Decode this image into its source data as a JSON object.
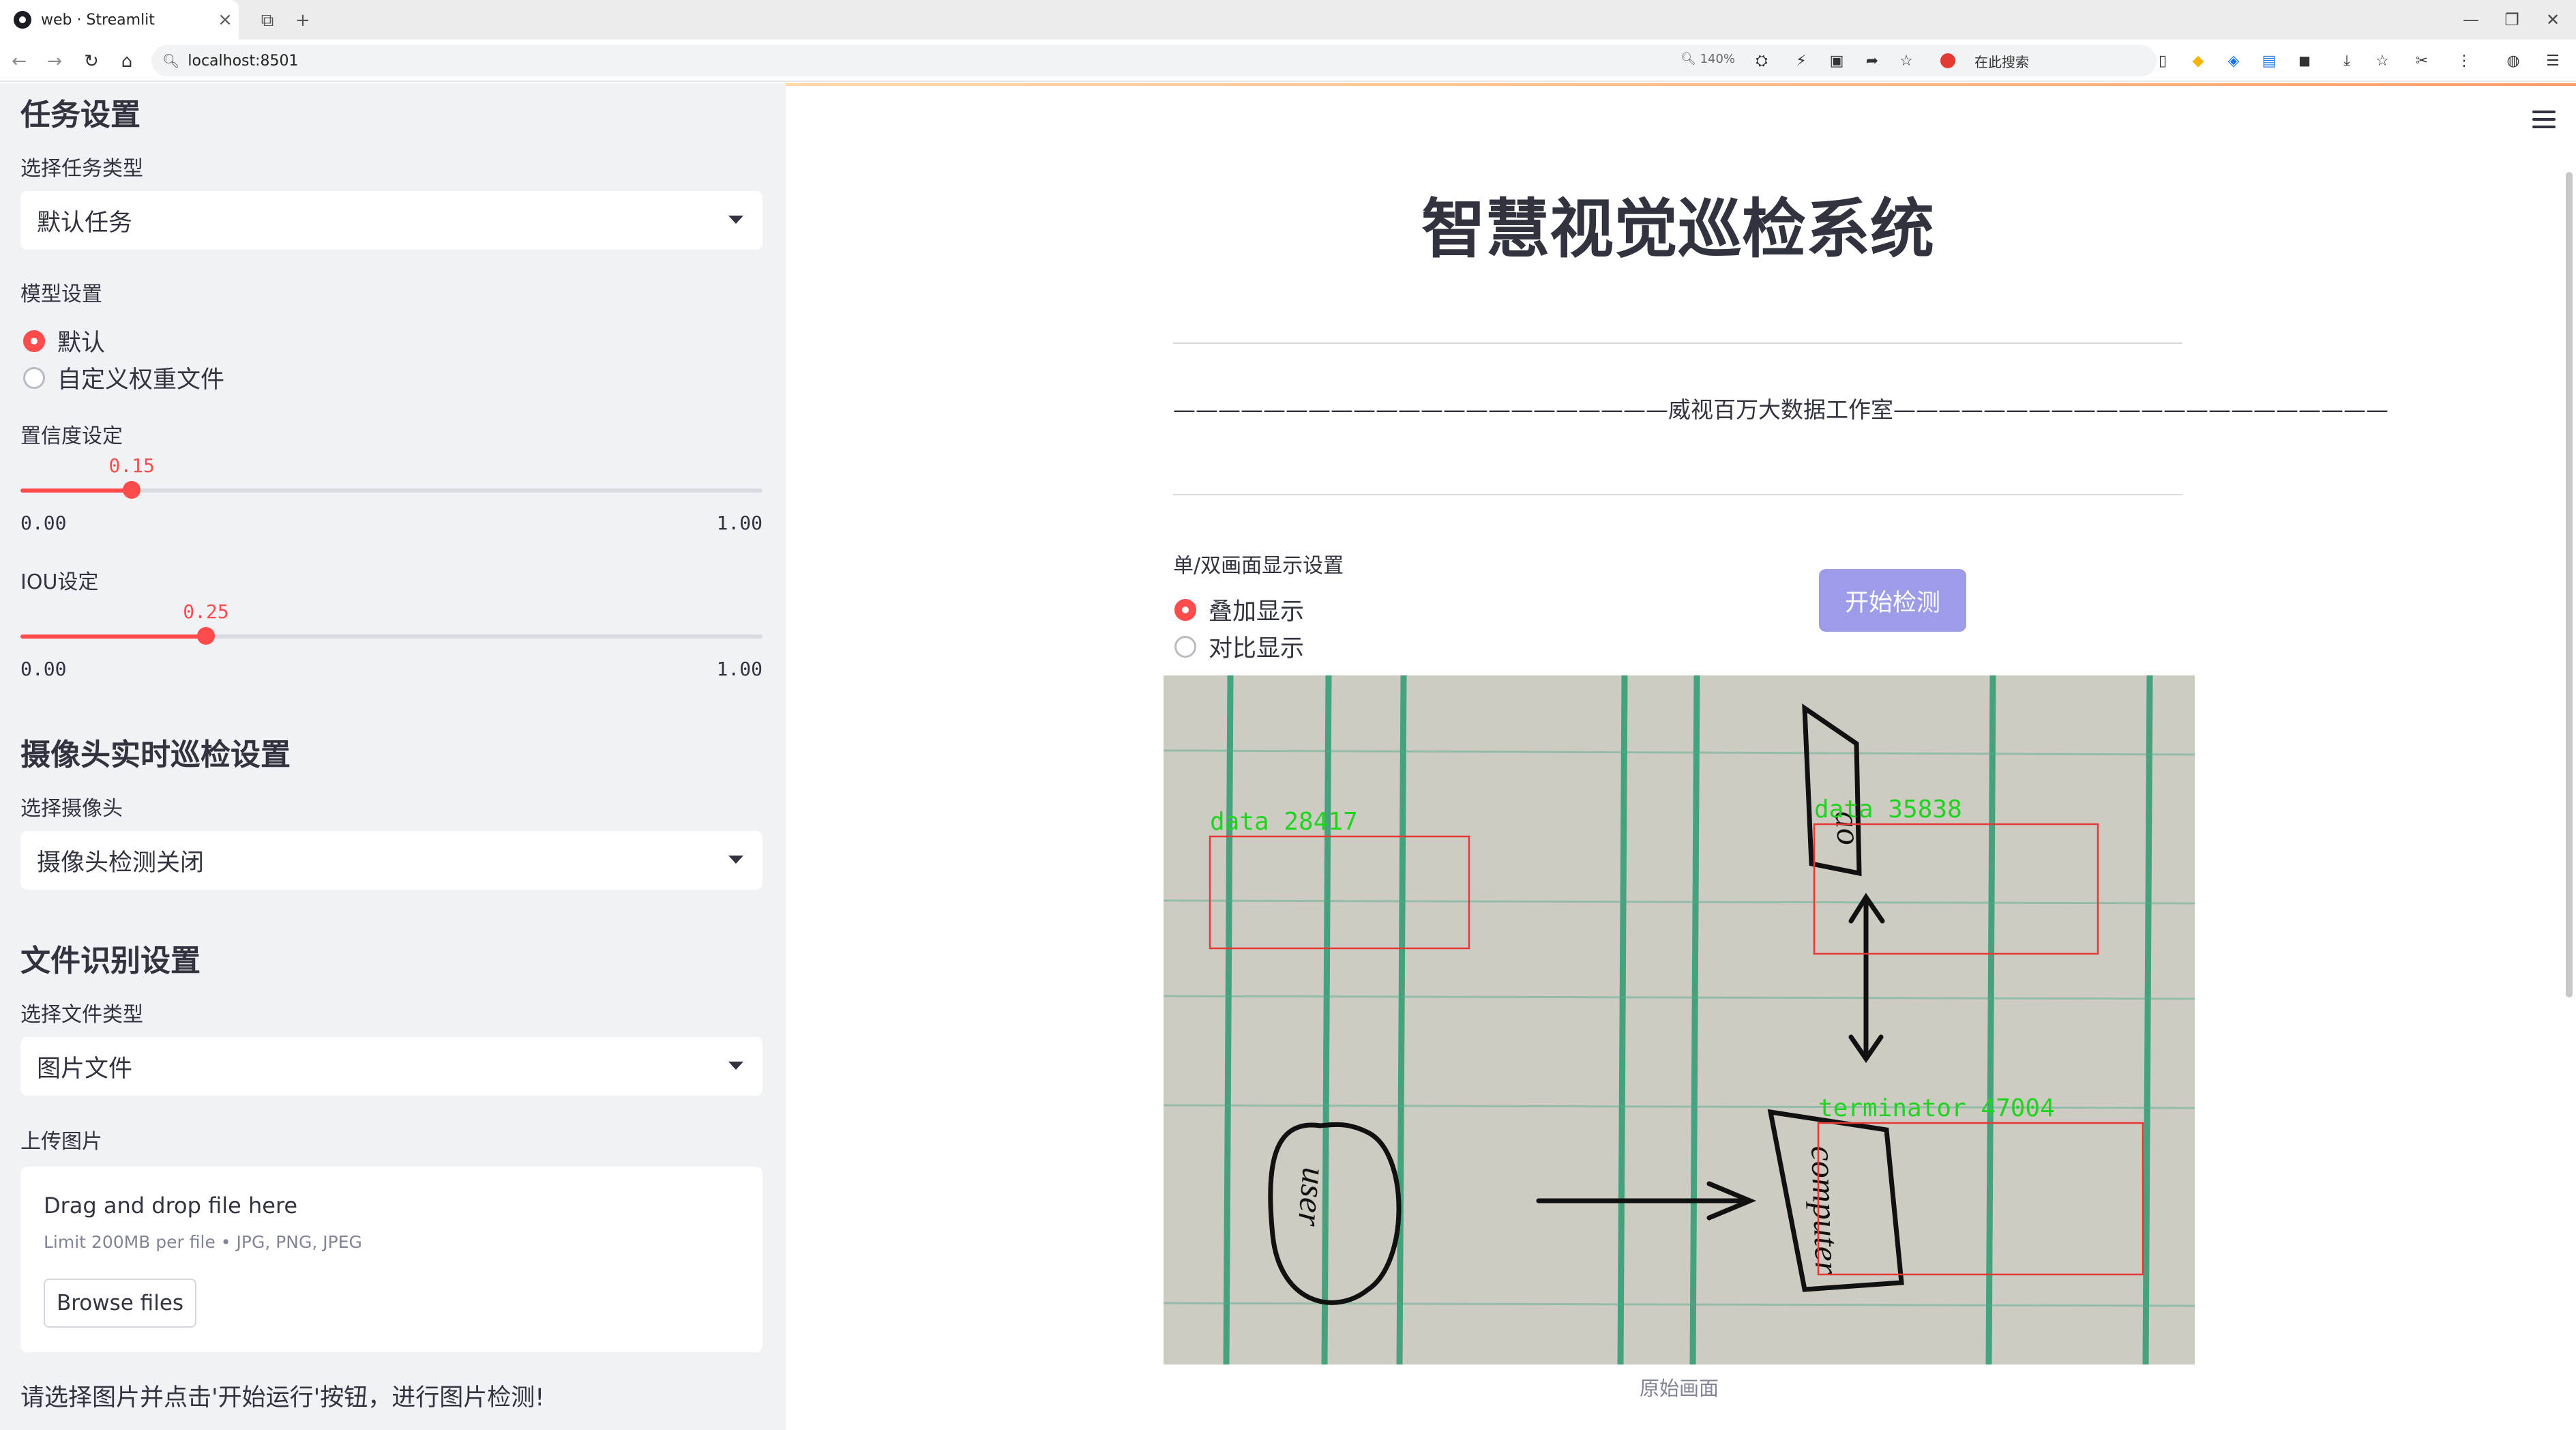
{
  "browser": {
    "tab_title": "web · Streamlit",
    "url": "localhost:8501",
    "zoom": "140%",
    "search_placeholder": "在此搜索"
  },
  "sidebar": {
    "task_section": {
      "heading": "任务设置",
      "select_label": "选择任务类型",
      "select_value": "默认任务"
    },
    "model_section": {
      "label": "模型设置",
      "options": [
        "默认",
        "自定义权重文件"
      ],
      "selected_index": 0
    },
    "confidence": {
      "label": "置信度设定",
      "value": "0.15",
      "min": "0.00",
      "max": "1.00",
      "fraction": 0.15
    },
    "iou": {
      "label": "IOU设定",
      "value": "0.25",
      "min": "0.00",
      "max": "1.00",
      "fraction": 0.25
    },
    "camera_section": {
      "heading": "摄像头实时巡检设置",
      "select_label": "选择摄像头",
      "select_value": "摄像头检测关闭"
    },
    "file_section": {
      "heading": "文件识别设置",
      "select_label": "选择文件类型",
      "select_value": "图片文件",
      "upload_label": "上传图片",
      "drop_text": "Drag and drop file here",
      "limit_text": "Limit 200MB per file • JPG, PNG, JPEG",
      "browse_label": "Browse files"
    },
    "note": "请选择图片并点击'开始运行'按钮，进行图片检测!"
  },
  "main": {
    "title": "智慧视觉巡检系统",
    "studio_line": "——————————————————————威视百万大数据工作室——————————————————————",
    "display_label": "单/双画面显示设置",
    "display_options": [
      "叠加显示",
      "对比显示"
    ],
    "display_selected_index": 0,
    "start_button": "开始检测",
    "caption": "原始画面",
    "detections": [
      {
        "label": "data 28417"
      },
      {
        "label": "data 35838"
      },
      {
        "label": "terminator 47004"
      }
    ],
    "sketch_labels": {
      "user": "user",
      "computer": "computer"
    }
  },
  "colors": {
    "accent": "#ff4b4b",
    "button": "#9d9ce8",
    "sidebar_bg": "#f0f2f6",
    "det_box": "#e53935",
    "det_text": "#1fd41f"
  }
}
